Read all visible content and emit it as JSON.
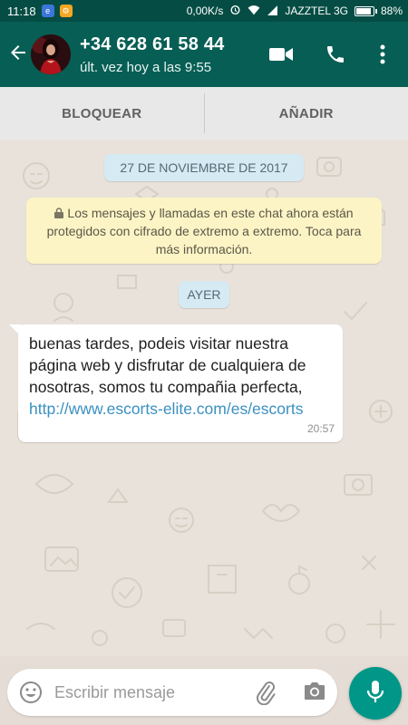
{
  "status_bar": {
    "time": "11:18",
    "network_speed": "0,00K/s",
    "carrier": "JAZZTEL 3G",
    "battery": "88%",
    "battery_level": 0.88
  },
  "header": {
    "contact_name": "+34 628 61 58 44",
    "last_seen": "últ. vez hoy a las 9:55"
  },
  "actions": {
    "block_label": "BLOQUEAR",
    "add_label": "AÑADIR"
  },
  "chat": {
    "date_chip": "27 DE NOVIEMBRE DE 2017",
    "encryption_notice": "Los mensajes y llamadas en este chat ahora están protegidos con cifrado de extremo a extremo. Toca para más información.",
    "day_chip": "AYER",
    "message": {
      "text": "buenas tardes, podeis visitar nuestra página web y disfrutar de cualquiera de nosotras, somos tu compañia perfecta, ",
      "link": "http://www.escorts-elite.com/es/escorts",
      "time": "20:57"
    }
  },
  "composer": {
    "placeholder": "Escribir mensaje"
  },
  "colors": {
    "status_bar": "#054d44",
    "app_bar": "#075e54",
    "chat_background": "#e9e2da",
    "date_chip": "#d5eaf3",
    "notice": "#fdf4c5",
    "link": "#3a90c2",
    "mic_button": "#009688"
  },
  "icons": [
    "back-arrow-icon",
    "video-call-icon",
    "phone-icon",
    "more-vert-icon",
    "lock-icon",
    "emoji-icon",
    "attach-clip-icon",
    "camera-icon",
    "mic-icon"
  ]
}
